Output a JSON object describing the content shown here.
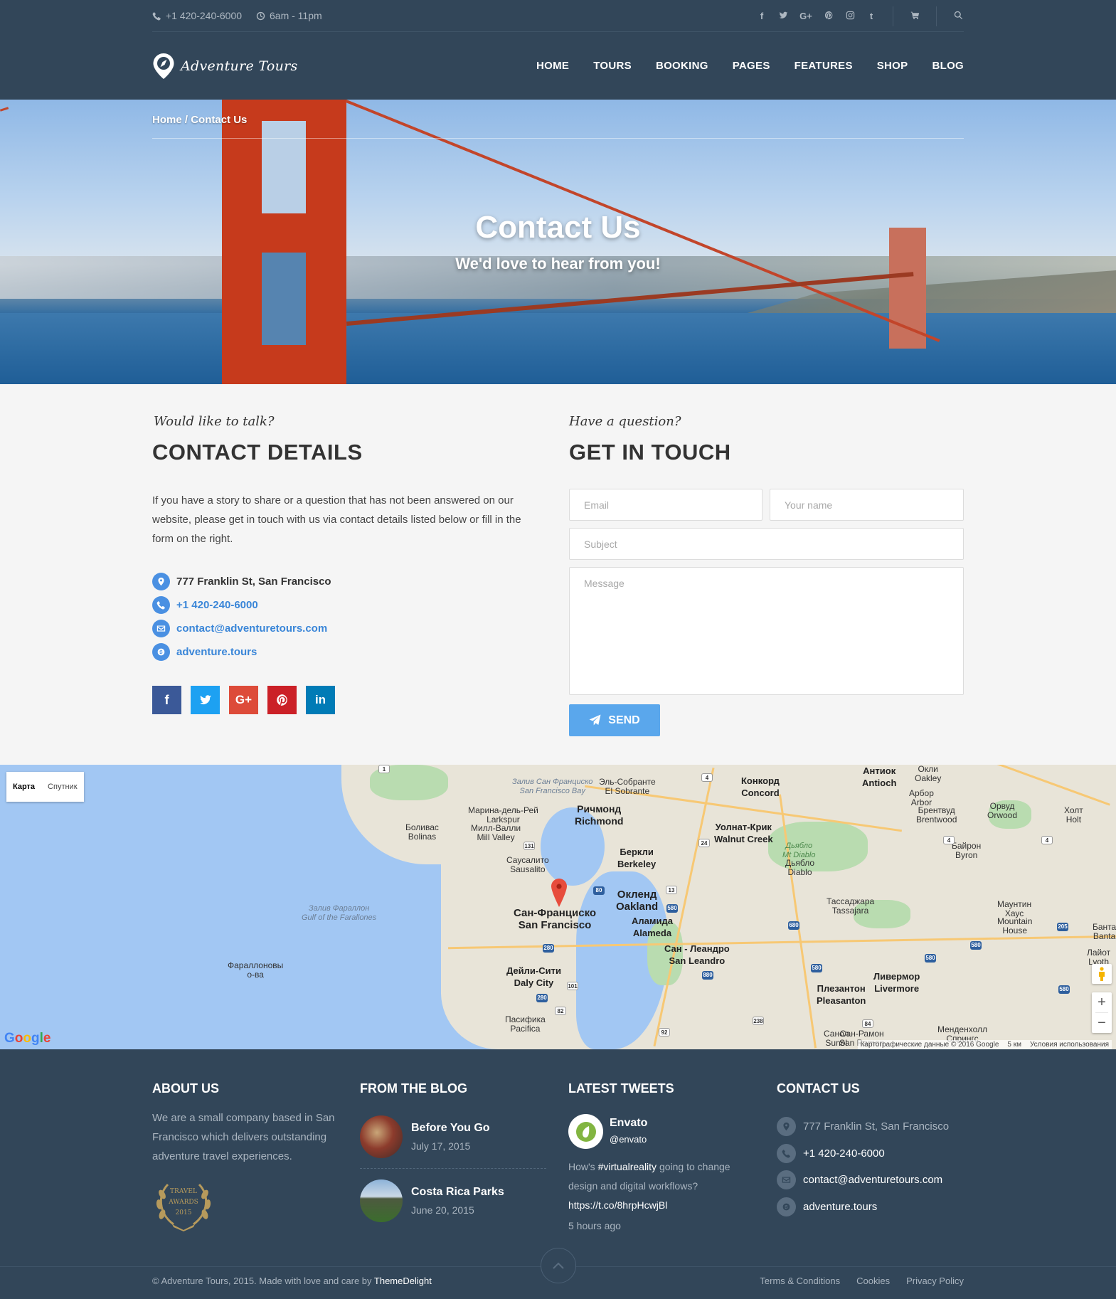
{
  "topbar": {
    "phone": "+1 420-240-6000",
    "hours": "6am - 11pm",
    "socials": [
      "facebook-icon",
      "twitter-icon",
      "google-plus-icon",
      "pinterest-icon",
      "instagram-icon",
      "tumblr-icon"
    ]
  },
  "header": {
    "logo_text": "Adventure Tours",
    "nav": [
      "HOME",
      "TOURS",
      "BOOKING",
      "PAGES",
      "FEATURES",
      "SHOP",
      "BLOG"
    ]
  },
  "hero": {
    "breadcrumb_home": "Home",
    "breadcrumb_sep": " / ",
    "breadcrumb_current": "Contact Us",
    "title": "Contact Us",
    "subtitle": "We'd love to hear from you!"
  },
  "contact_details": {
    "kicker": "Would like to talk?",
    "heading": "CONTACT DETAILS",
    "intro": "If you have a story to share or a question that has not been answered on our website, please get in touch with us via contact details listed below or fill in the form on the right.",
    "address": "777 Franklin St, San Francisco",
    "phone": "+1 420-240-6000",
    "email": "contact@adventuretours.com",
    "skype": "adventure.tours",
    "socials": [
      {
        "icon": "facebook-icon",
        "color": "#3b5998"
      },
      {
        "icon": "twitter-icon",
        "color": "#1da1f2"
      },
      {
        "icon": "google-plus-icon",
        "color": "#dd4b39"
      },
      {
        "icon": "pinterest-icon",
        "color": "#cb2027"
      },
      {
        "icon": "linkedin-icon",
        "color": "#007bb6"
      }
    ]
  },
  "form": {
    "kicker": "Have a question?",
    "heading": "GET IN TOUCH",
    "email_placeholder": "Email",
    "name_placeholder": "Your name",
    "subject_placeholder": "Subject",
    "message_placeholder": "Message",
    "send_label": "SEND"
  },
  "map": {
    "map_type_map": "Карта",
    "map_type_satellite": "Спутник",
    "logo": "Google",
    "attribution": "Картографические данные © 2016 Google",
    "scale": "5 км",
    "terms": "Условия использования",
    "labels": [
      {
        "t": "Сан-Франциско",
        "sub": "San Francisco",
        "big": true
      },
      {
        "t": "Окленд",
        "sub": "Oakland",
        "big": true
      },
      {
        "t": "Ричмонд",
        "sub": "Richmond",
        "big": true
      },
      {
        "t": "Конкорд",
        "sub": "Concord",
        "big": true
      },
      {
        "t": "Уолнат-Крик",
        "sub": "Walnut Creek",
        "big": true
      },
      {
        "t": "Беркли",
        "sub": "Berkeley",
        "big": true
      },
      {
        "t": "Аламида",
        "sub": "Alameda",
        "big": true
      },
      {
        "t": "Сан - Леандро",
        "sub": "San Leandro",
        "big": true
      },
      {
        "t": "Дейли-Сити",
        "sub": "Daly City",
        "big": true
      },
      {
        "t": "Ливермор",
        "sub": "Livermore",
        "big": true
      },
      {
        "t": "Плезантон",
        "sub": "Pleasanton",
        "big": true
      },
      {
        "t": "Антиок",
        "sub": "Antioch",
        "big": true
      },
      {
        "t": "Сан-Рамон",
        "sub": "San Ramon",
        "big": false
      },
      {
        "t": "Эль-Собранте",
        "sub": "El Sobrante",
        "big": false
      },
      {
        "t": "Марина-дель-Рей",
        "sub": "Larkspur",
        "big": false
      },
      {
        "t": "Милл-Валли",
        "sub": "Mill Valley",
        "big": false
      },
      {
        "t": "Боливас",
        "sub": "Bolinas",
        "big": false
      },
      {
        "t": "Саусалито",
        "sub": "Sausalito",
        "big": false
      },
      {
        "t": "Пасифика",
        "sub": "Pacifica",
        "big": false
      },
      {
        "t": "Фараллоновы",
        "sub": "о-ва",
        "big": false
      },
      {
        "t": "Окли",
        "sub": "Oakley",
        "big": false
      },
      {
        "t": "Брентвуд",
        "sub": "Brentwood",
        "big": false
      },
      {
        "t": "Арбор",
        "sub": "Arbor",
        "big": false
      },
      {
        "t": "Орвуд",
        "sub": "Orwood",
        "big": false
      },
      {
        "t": "Холт",
        "sub": "Holt",
        "big": false
      },
      {
        "t": "Байрон",
        "sub": "Byron",
        "big": false
      },
      {
        "t": "Дьябло",
        "sub": "Diablo",
        "big": false
      },
      {
        "t": "Тассаджара",
        "sub": "Tassajara",
        "big": false
      },
      {
        "t": "Маунтин",
        "sub": "Хаус",
        "big": false
      },
      {
        "t": "Mountain",
        "sub": "House",
        "big": false
      },
      {
        "t": "Банта",
        "sub": "Banta",
        "big": false
      },
      {
        "t": "Лайот",
        "sub": "Lyoth",
        "big": false
      },
      {
        "t": "Менденхолл",
        "sub": "Спрингс",
        "big": false
      },
      {
        "t": "Санол",
        "sub": "Sunol",
        "big": false
      }
    ],
    "water_labels": [
      {
        "t": "Залив Сан Франциско",
        "sub": "San Francisco Bay"
      },
      {
        "t": "Залив Фараллон",
        "sub": "Gulf of the Farallones"
      }
    ],
    "park_labels": [
      {
        "t": "Дьябло",
        "sub": "Mt Diablo"
      }
    ],
    "route_shields": [
      "1",
      "4",
      "4",
      "4",
      "24",
      "80",
      "131",
      "13",
      "580",
      "280",
      "680",
      "580",
      "580",
      "580",
      "580",
      "880",
      "101",
      "280",
      "82",
      "84",
      "238",
      "92",
      "205"
    ]
  },
  "footer": {
    "about_head": "ABOUT US",
    "about_text": "We are a small company based in San Francisco which delivers outstanding adventure travel experiences.",
    "award_lines": [
      "TRAVEL",
      "AWARDS",
      "2015"
    ],
    "blog_head": "FROM THE BLOG",
    "posts": [
      {
        "title": "Before You Go",
        "date": "July 17, 2015"
      },
      {
        "title": "Costa Rica Parks",
        "date": "June 20, 2015"
      }
    ],
    "tweets_head": "LATEST TWEETS",
    "tweet": {
      "name": "Envato",
      "handle": "@envato",
      "text_pre": "How's ",
      "text_hashtag": "#virtualreality",
      "text_post": " going to change design and digital workflows? ",
      "text_link": "https://t.co/8hrpHcwjBl",
      "time": "5 hours ago"
    },
    "contact_head": "CONTACT US",
    "address": "777 Franklin St, San Francisco",
    "phone": "+1 420-240-6000",
    "email": "contact@adventuretours.com",
    "skype": "adventure.tours",
    "copyright_pre": "© Adventure Tours, 2015. Made with love and care by ",
    "copyright_brand": "ThemeDelight",
    "legal": [
      "Terms & Conditions",
      "Cookies",
      "Privacy Policy"
    ]
  }
}
